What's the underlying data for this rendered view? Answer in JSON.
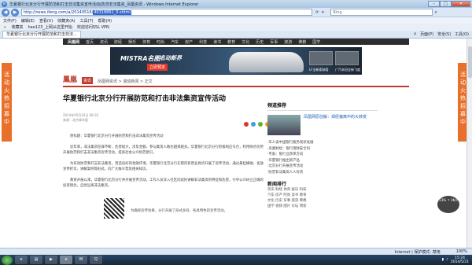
{
  "window": {
    "title": "华夏银行北京分行开展防范和打击非法集资宣传活动|防范非法集资_凤凰资讯 - Windows Internet Explorer",
    "icon": "ie-icon"
  },
  "toolbar": {
    "back_icon": "◀",
    "forward_icon": "▶",
    "url_display": "http://news.ifeng.com/a/20140516/",
    "url_selected": "40318861_0.shtml",
    "search_placeholder": "Bing"
  },
  "menu": [
    "文件(F)",
    "编辑(E)",
    "查看(V)",
    "收藏夹(A)",
    "工具(T)",
    "帮助(H)"
  ],
  "favorites": {
    "label": "收藏夹",
    "items": [
      "hao123_上网从这里开始",
      "欢迎访问SSL VPN"
    ]
  },
  "tabs": [
    {
      "label": "华夏银行北京分行开展防范和打击非法..."
    }
  ],
  "commands": [
    "页面(P)",
    "安全(S)",
    "工具(O)"
  ],
  "page": {
    "topnav": [
      "凤凰网",
      "首页",
      "资讯",
      "财经",
      "娱乐",
      "体育",
      "时尚",
      "汽车",
      "房产",
      "科技",
      "读书",
      "教育",
      "文化",
      "历史",
      "军事",
      "旅游",
      "佛教",
      "国学"
    ],
    "banner": {
      "brand": "MISTRA名图",
      "tagline": "名动新界",
      "cta": "立即预定",
      "thumb1_caption": "LF全新索纳塔",
      "thumb2_caption": "广汽本田全新飞度"
    },
    "site": {
      "logo": "鳳凰",
      "section_badge": "资讯",
      "breadcrumb": "凤凰网资讯 > 滚动新闻 > 正文"
    },
    "side_ad": "活动火热招募中",
    "article": {
      "title": "华夏银行北京分行开展防范和打击非法集资宣传活动",
      "date": "2014年05月16日 08:32",
      "source": "来源：北京青年报",
      "paragraphs": [
        "原标题：华夏银行北京分行开展防范和打击非法集资宣传活动",
        "近年来，非法集资犯罪不断，危害极大，涉及金额、参与集资人数也越来越多。华夏银行北京分行积极响应号召，利用网点优势开展防范和打击非法集资宣传活动，提高社会公众防范意识。",
        "为有效防范和打击非法集资，营造良好的金融环境，华夏银行北京分行在辖内各营业网点开展了宣传活动，通过悬挂横幅、发放宣传折页、讲解案例等形式，向广大群众普及相关知识。",
        "教育开展以来，华夏银行北京分行共开展宣传活动，工作人员深入社区向居民讲解非法集资的特征和危害，引导公众树立正确的投资理念，自觉远离非法集资。"
      ],
      "closing": "为确保宣传效果，分行开展了形式多样、各具特色的宣传活动。"
    },
    "sidebar": {
      "heading": "频道推荐",
      "pic_title": "凤凰网原创解：郑经偏离中的大转变",
      "news": [
        "·华人谈中国银行服务现状发展",
        "·凤凰财经：银行理财安全吗",
        "·专家：银行业改革方向",
        "·华夏银行推出新产品",
        "·北京分行开展宣传活动",
        "·防范非法集资人人有责"
      ],
      "section2": "新闻排行",
      "grid": [
        "资讯 财经 体育 娱乐 科技",
        "汽车 房产 时尚 读书 教育",
        "文化 历史 军事 旅游 佛教",
        "国学 视频 图片 论坛 博客"
      ]
    },
    "weather_widget": "23% ↑ 0K/s"
  },
  "status": {
    "zone": "Internet | 保护模式: 禁用",
    "zoom": "100%"
  },
  "clock": {
    "time": "15:24",
    "date": "2014/5/21"
  }
}
